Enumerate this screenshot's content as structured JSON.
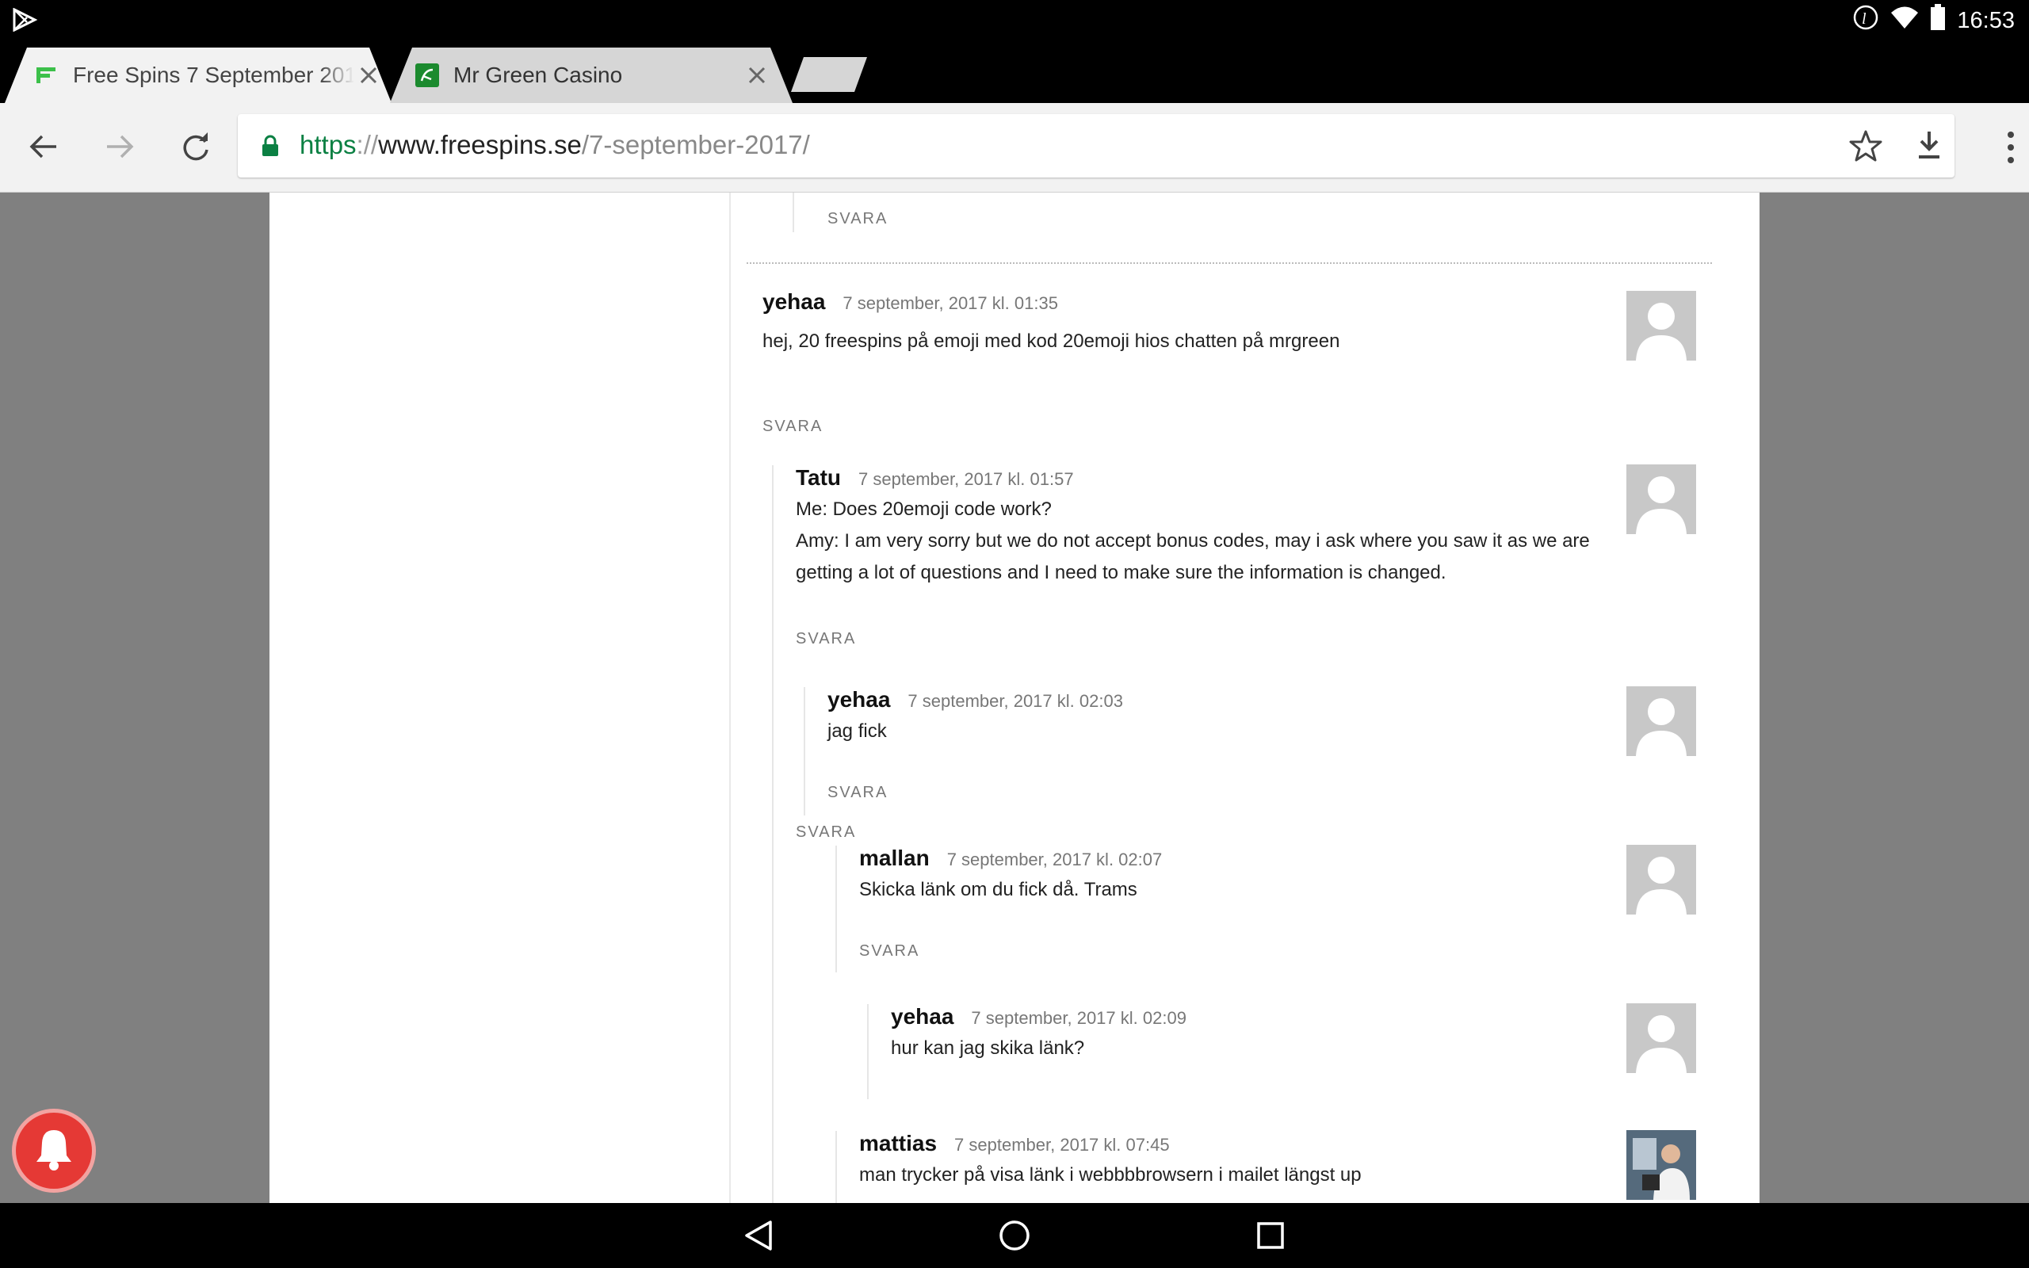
{
  "status_bar": {
    "time": "16:53"
  },
  "tabs": [
    {
      "title": "Free Spins 7 September 2017",
      "active": true
    },
    {
      "title": "Mr Green Casino",
      "active": false
    }
  ],
  "address_bar": {
    "scheme": "https",
    "separator": "://",
    "host": "www.freespins.se",
    "path": "/7-september-2017/"
  },
  "reply_label": "SVARA",
  "comments": [
    {
      "author": "yehaa",
      "date": "7 september, 2017 kl. 01:35",
      "lines": [
        "hej, 20 freespins på emoji med kod 20emoji hios chatten på mrgreen"
      ]
    },
    {
      "author": "Tatu",
      "date": "7 september, 2017 kl. 01:57",
      "lines": [
        "Me: Does 20emoji code work?",
        "Amy: I am very sorry but we do not accept bonus codes, may i ask where you saw it as we are",
        "getting a lot of questions and I need to make sure the information is changed."
      ]
    },
    {
      "author": "yehaa",
      "date": "7 september, 2017 kl. 02:03",
      "lines": [
        "jag fick"
      ]
    },
    {
      "author": "mallan",
      "date": "7 september, 2017 kl. 02:07",
      "lines": [
        "Skicka länk om du fick då. Trams"
      ]
    },
    {
      "author": "yehaa",
      "date": "7 september, 2017 kl. 02:09",
      "lines": [
        "hur kan jag skika länk?"
      ]
    },
    {
      "author": "mattias",
      "date": "7 september, 2017 kl. 07:45",
      "lines": [
        "man trycker på visa länk i webbbbrowsern i mailet längst up"
      ]
    }
  ],
  "colors": {
    "accent_green": "#0b8043",
    "notification_red": "#e53935"
  }
}
